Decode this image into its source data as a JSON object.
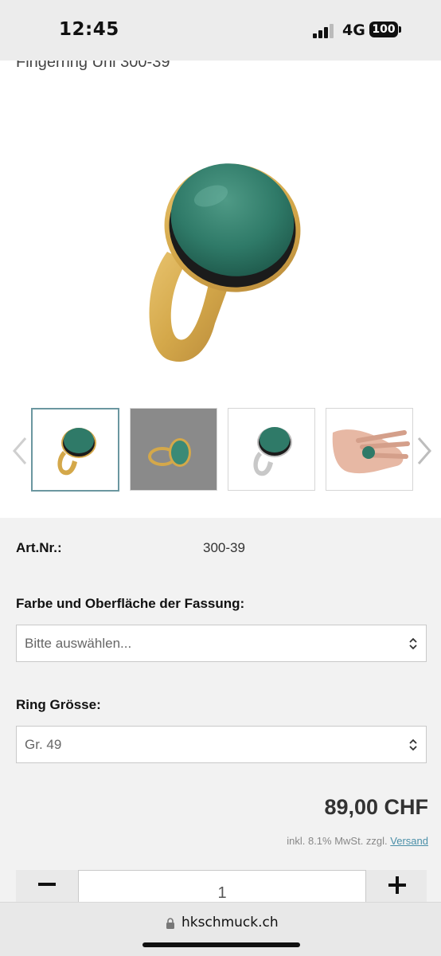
{
  "status_bar": {
    "time": "12:45",
    "network": "4G",
    "battery": "100"
  },
  "product": {
    "title": "Fingerring Uni 300-39"
  },
  "gallery": {
    "thumbnails": [
      "gold-ring-white-background",
      "gold-ring-grey-background",
      "silver-ring-white-background",
      "ring-on-hand"
    ],
    "active_index": 0
  },
  "details": {
    "art_nr_label": "Art.Nr.:",
    "art_nr_value": "300-39",
    "color_label": "Farbe und Oberfläche der Fassung:",
    "color_placeholder": "Bitte auswählen...",
    "size_label": "Ring Grösse:",
    "size_value": "Gr. 49",
    "price": "89,00 CHF",
    "tax_text": "inkl. 8.1% MwSt. zzgl.",
    "shipping_link": "Versand",
    "quantity": "1"
  },
  "browser": {
    "domain": "hkschmuck.ch"
  },
  "colors": {
    "accent": "#4a8fa8",
    "stone": "#2f7a68",
    "gold": "#d4a84a"
  }
}
